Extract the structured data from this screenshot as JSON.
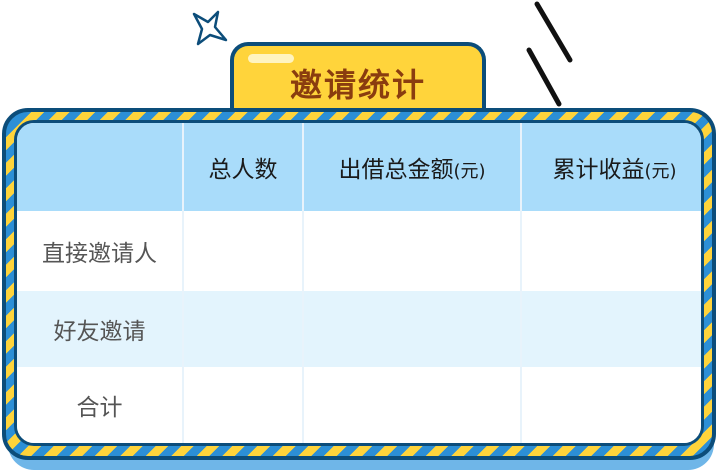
{
  "title": "邀请统计",
  "table": {
    "headers": [
      "",
      "总人数",
      "出借总金额",
      "累计收益"
    ],
    "header_units": [
      "",
      "",
      "(元)",
      "(元)"
    ],
    "rows": [
      {
        "label": "直接邀请人",
        "values": [
          "",
          "",
          ""
        ]
      },
      {
        "label": "好友邀请",
        "values": [
          "",
          "",
          ""
        ]
      },
      {
        "label": "合计",
        "values": [
          "",
          "",
          ""
        ]
      }
    ]
  },
  "colors": {
    "title_bg": "#ffd43b",
    "title_text": "#8a3d0f",
    "frame_dark": "#0c4d7a",
    "stripe_yellow": "#ffd43b",
    "stripe_blue": "#2c8fd6",
    "header_bg": "#a9dcfa",
    "alt_row_bg": "#e3f4fd"
  },
  "icons": {
    "decor_star": "star-outline-icon",
    "decor_slashes": "slash-lines-icon"
  }
}
